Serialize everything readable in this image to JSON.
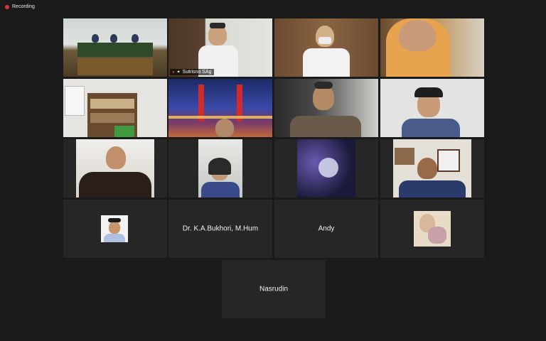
{
  "recording": {
    "label": "Recording"
  },
  "participants": [
    {
      "name": "",
      "kind": "video-room"
    },
    {
      "name": "Sutrisno SAg",
      "kind": "video-person",
      "active": true
    },
    {
      "name": "",
      "kind": "video-person"
    },
    {
      "name": "",
      "kind": "video-person"
    },
    {
      "name": "",
      "kind": "video-room"
    },
    {
      "name": "",
      "kind": "video-bridge"
    },
    {
      "name": "",
      "kind": "video-person"
    },
    {
      "name": "",
      "kind": "video-person"
    },
    {
      "name": "",
      "kind": "video-person"
    },
    {
      "name": "",
      "kind": "video-person"
    },
    {
      "name": "",
      "kind": "video-space"
    },
    {
      "name": "",
      "kind": "video-person"
    },
    {
      "name": "",
      "kind": "profile-photo"
    },
    {
      "name": "Dr. K.A.Bukhori, M.Hum",
      "kind": "name-only"
    },
    {
      "name": "Andy",
      "kind": "name-only"
    },
    {
      "name": "",
      "kind": "profile-photo"
    },
    {
      "name": "Nasrudin",
      "kind": "name-only"
    }
  ],
  "colors": {
    "active_border": "#b6d957",
    "recording_dot": "#e0322f",
    "tile_bg": "#262626",
    "page_bg": "#1a1a1a"
  },
  "icons": {
    "mic_muted": "mic-muted-icon",
    "pin": "pin-icon",
    "recording": "recording-dot-icon"
  }
}
